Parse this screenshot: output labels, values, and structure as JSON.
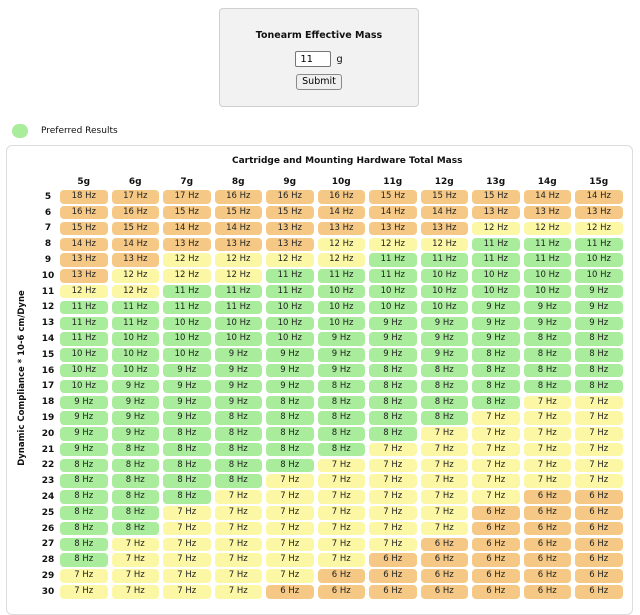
{
  "form": {
    "title": "Tonearm Effective Mass",
    "mass_value": "11",
    "unit": "g",
    "submit_label": "Submit"
  },
  "legend": {
    "label": "Preferred Results",
    "color": "#a8ec9c"
  },
  "colors": {
    "orange": "#f5c985",
    "yellow": "#fcf7a5",
    "green": "#a8ec9c"
  },
  "table": {
    "title": "Cartridge and Mounting Hardware Total Mass",
    "y_label": "Dynamic Compliance * 10-6 cm/Dyne",
    "columns": [
      "5g",
      "6g",
      "7g",
      "8g",
      "9g",
      "10g",
      "11g",
      "12g",
      "13g",
      "14g",
      "15g"
    ],
    "rows": [
      {
        "label": "5",
        "cells": [
          [
            "18 Hz",
            "o"
          ],
          [
            "17 Hz",
            "o"
          ],
          [
            "17 Hz",
            "o"
          ],
          [
            "16 Hz",
            "o"
          ],
          [
            "16 Hz",
            "o"
          ],
          [
            "16 Hz",
            "o"
          ],
          [
            "15 Hz",
            "o"
          ],
          [
            "15 Hz",
            "o"
          ],
          [
            "15 Hz",
            "o"
          ],
          [
            "14 Hz",
            "o"
          ],
          [
            "14 Hz",
            "o"
          ]
        ]
      },
      {
        "label": "6",
        "cells": [
          [
            "16 Hz",
            "o"
          ],
          [
            "16 Hz",
            "o"
          ],
          [
            "15 Hz",
            "o"
          ],
          [
            "15 Hz",
            "o"
          ],
          [
            "15 Hz",
            "o"
          ],
          [
            "14 Hz",
            "o"
          ],
          [
            "14 Hz",
            "o"
          ],
          [
            "14 Hz",
            "o"
          ],
          [
            "13 Hz",
            "o"
          ],
          [
            "13 Hz",
            "o"
          ],
          [
            "13 Hz",
            "o"
          ]
        ]
      },
      {
        "label": "7",
        "cells": [
          [
            "15 Hz",
            "o"
          ],
          [
            "15 Hz",
            "o"
          ],
          [
            "14 Hz",
            "o"
          ],
          [
            "14 Hz",
            "o"
          ],
          [
            "13 Hz",
            "o"
          ],
          [
            "13 Hz",
            "o"
          ],
          [
            "13 Hz",
            "o"
          ],
          [
            "13 Hz",
            "o"
          ],
          [
            "12 Hz",
            "y"
          ],
          [
            "12 Hz",
            "y"
          ],
          [
            "12 Hz",
            "y"
          ]
        ]
      },
      {
        "label": "8",
        "cells": [
          [
            "14 Hz",
            "o"
          ],
          [
            "14 Hz",
            "o"
          ],
          [
            "13 Hz",
            "o"
          ],
          [
            "13 Hz",
            "o"
          ],
          [
            "13 Hz",
            "o"
          ],
          [
            "12 Hz",
            "y"
          ],
          [
            "12 Hz",
            "y"
          ],
          [
            "12 Hz",
            "y"
          ],
          [
            "11 Hz",
            "g"
          ],
          [
            "11 Hz",
            "g"
          ],
          [
            "11 Hz",
            "g"
          ]
        ]
      },
      {
        "label": "9",
        "cells": [
          [
            "13 Hz",
            "o"
          ],
          [
            "13 Hz",
            "o"
          ],
          [
            "12 Hz",
            "y"
          ],
          [
            "12 Hz",
            "y"
          ],
          [
            "12 Hz",
            "y"
          ],
          [
            "12 Hz",
            "y"
          ],
          [
            "11 Hz",
            "g"
          ],
          [
            "11 Hz",
            "g"
          ],
          [
            "11 Hz",
            "g"
          ],
          [
            "11 Hz",
            "g"
          ],
          [
            "10 Hz",
            "g"
          ]
        ]
      },
      {
        "label": "10",
        "cells": [
          [
            "13 Hz",
            "o"
          ],
          [
            "12 Hz",
            "y"
          ],
          [
            "12 Hz",
            "y"
          ],
          [
            "12 Hz",
            "y"
          ],
          [
            "11 Hz",
            "g"
          ],
          [
            "11 Hz",
            "g"
          ],
          [
            "11 Hz",
            "g"
          ],
          [
            "10 Hz",
            "g"
          ],
          [
            "10 Hz",
            "g"
          ],
          [
            "10 Hz",
            "g"
          ],
          [
            "10 Hz",
            "g"
          ]
        ]
      },
      {
        "label": "11",
        "cells": [
          [
            "12 Hz",
            "y"
          ],
          [
            "12 Hz",
            "y"
          ],
          [
            "11 Hz",
            "g"
          ],
          [
            "11 Hz",
            "g"
          ],
          [
            "11 Hz",
            "g"
          ],
          [
            "10 Hz",
            "g"
          ],
          [
            "10 Hz",
            "g"
          ],
          [
            "10 Hz",
            "g"
          ],
          [
            "10 Hz",
            "g"
          ],
          [
            "10 Hz",
            "g"
          ],
          [
            "9 Hz",
            "g"
          ]
        ]
      },
      {
        "label": "12",
        "cells": [
          [
            "11 Hz",
            "g"
          ],
          [
            "11 Hz",
            "g"
          ],
          [
            "11 Hz",
            "g"
          ],
          [
            "11 Hz",
            "g"
          ],
          [
            "10 Hz",
            "g"
          ],
          [
            "10 Hz",
            "g"
          ],
          [
            "10 Hz",
            "g"
          ],
          [
            "10 Hz",
            "g"
          ],
          [
            "9 Hz",
            "g"
          ],
          [
            "9 Hz",
            "g"
          ],
          [
            "9 Hz",
            "g"
          ]
        ]
      },
      {
        "label": "13",
        "cells": [
          [
            "11 Hz",
            "g"
          ],
          [
            "11 Hz",
            "g"
          ],
          [
            "10 Hz",
            "g"
          ],
          [
            "10 Hz",
            "g"
          ],
          [
            "10 Hz",
            "g"
          ],
          [
            "10 Hz",
            "g"
          ],
          [
            "9 Hz",
            "g"
          ],
          [
            "9 Hz",
            "g"
          ],
          [
            "9 Hz",
            "g"
          ],
          [
            "9 Hz",
            "g"
          ],
          [
            "9 Hz",
            "g"
          ]
        ]
      },
      {
        "label": "14",
        "cells": [
          [
            "11 Hz",
            "g"
          ],
          [
            "10 Hz",
            "g"
          ],
          [
            "10 Hz",
            "g"
          ],
          [
            "10 Hz",
            "g"
          ],
          [
            "10 Hz",
            "g"
          ],
          [
            "9 Hz",
            "g"
          ],
          [
            "9 Hz",
            "g"
          ],
          [
            "9 Hz",
            "g"
          ],
          [
            "9 Hz",
            "g"
          ],
          [
            "8 Hz",
            "g"
          ],
          [
            "8 Hz",
            "g"
          ]
        ]
      },
      {
        "label": "15",
        "cells": [
          [
            "10 Hz",
            "g"
          ],
          [
            "10 Hz",
            "g"
          ],
          [
            "10 Hz",
            "g"
          ],
          [
            "9 Hz",
            "g"
          ],
          [
            "9 Hz",
            "g"
          ],
          [
            "9 Hz",
            "g"
          ],
          [
            "9 Hz",
            "g"
          ],
          [
            "9 Hz",
            "g"
          ],
          [
            "8 Hz",
            "g"
          ],
          [
            "8 Hz",
            "g"
          ],
          [
            "8 Hz",
            "g"
          ]
        ]
      },
      {
        "label": "16",
        "cells": [
          [
            "10 Hz",
            "g"
          ],
          [
            "10 Hz",
            "g"
          ],
          [
            "9 Hz",
            "g"
          ],
          [
            "9 Hz",
            "g"
          ],
          [
            "9 Hz",
            "g"
          ],
          [
            "9 Hz",
            "g"
          ],
          [
            "8 Hz",
            "g"
          ],
          [
            "8 Hz",
            "g"
          ],
          [
            "8 Hz",
            "g"
          ],
          [
            "8 Hz",
            "g"
          ],
          [
            "8 Hz",
            "g"
          ]
        ]
      },
      {
        "label": "17",
        "cells": [
          [
            "10 Hz",
            "g"
          ],
          [
            "9 Hz",
            "g"
          ],
          [
            "9 Hz",
            "g"
          ],
          [
            "9 Hz",
            "g"
          ],
          [
            "9 Hz",
            "g"
          ],
          [
            "8 Hz",
            "g"
          ],
          [
            "8 Hz",
            "g"
          ],
          [
            "8 Hz",
            "g"
          ],
          [
            "8 Hz",
            "g"
          ],
          [
            "8 Hz",
            "g"
          ],
          [
            "8 Hz",
            "g"
          ]
        ]
      },
      {
        "label": "18",
        "cells": [
          [
            "9 Hz",
            "g"
          ],
          [
            "9 Hz",
            "g"
          ],
          [
            "9 Hz",
            "g"
          ],
          [
            "9 Hz",
            "g"
          ],
          [
            "8 Hz",
            "g"
          ],
          [
            "8 Hz",
            "g"
          ],
          [
            "8 Hz",
            "g"
          ],
          [
            "8 Hz",
            "g"
          ],
          [
            "8 Hz",
            "g"
          ],
          [
            "7 Hz",
            "y"
          ],
          [
            "7 Hz",
            "y"
          ]
        ]
      },
      {
        "label": "19",
        "cells": [
          [
            "9 Hz",
            "g"
          ],
          [
            "9 Hz",
            "g"
          ],
          [
            "9 Hz",
            "g"
          ],
          [
            "8 Hz",
            "g"
          ],
          [
            "8 Hz",
            "g"
          ],
          [
            "8 Hz",
            "g"
          ],
          [
            "8 Hz",
            "g"
          ],
          [
            "8 Hz",
            "g"
          ],
          [
            "7 Hz",
            "y"
          ],
          [
            "7 Hz",
            "y"
          ],
          [
            "7 Hz",
            "y"
          ]
        ]
      },
      {
        "label": "20",
        "cells": [
          [
            "9 Hz",
            "g"
          ],
          [
            "9 Hz",
            "g"
          ],
          [
            "8 Hz",
            "g"
          ],
          [
            "8 Hz",
            "g"
          ],
          [
            "8 Hz",
            "g"
          ],
          [
            "8 Hz",
            "g"
          ],
          [
            "8 Hz",
            "g"
          ],
          [
            "7 Hz",
            "y"
          ],
          [
            "7 Hz",
            "y"
          ],
          [
            "7 Hz",
            "y"
          ],
          [
            "7 Hz",
            "y"
          ]
        ]
      },
      {
        "label": "21",
        "cells": [
          [
            "9 Hz",
            "g"
          ],
          [
            "8 Hz",
            "g"
          ],
          [
            "8 Hz",
            "g"
          ],
          [
            "8 Hz",
            "g"
          ],
          [
            "8 Hz",
            "g"
          ],
          [
            "8 Hz",
            "g"
          ],
          [
            "7 Hz",
            "y"
          ],
          [
            "7 Hz",
            "y"
          ],
          [
            "7 Hz",
            "y"
          ],
          [
            "7 Hz",
            "y"
          ],
          [
            "7 Hz",
            "y"
          ]
        ]
      },
      {
        "label": "22",
        "cells": [
          [
            "8 Hz",
            "g"
          ],
          [
            "8 Hz",
            "g"
          ],
          [
            "8 Hz",
            "g"
          ],
          [
            "8 Hz",
            "g"
          ],
          [
            "8 Hz",
            "g"
          ],
          [
            "7 Hz",
            "y"
          ],
          [
            "7 Hz",
            "y"
          ],
          [
            "7 Hz",
            "y"
          ],
          [
            "7 Hz",
            "y"
          ],
          [
            "7 Hz",
            "y"
          ],
          [
            "7 Hz",
            "y"
          ]
        ]
      },
      {
        "label": "23",
        "cells": [
          [
            "8 Hz",
            "g"
          ],
          [
            "8 Hz",
            "g"
          ],
          [
            "8 Hz",
            "g"
          ],
          [
            "8 Hz",
            "g"
          ],
          [
            "7 Hz",
            "y"
          ],
          [
            "7 Hz",
            "y"
          ],
          [
            "7 Hz",
            "y"
          ],
          [
            "7 Hz",
            "y"
          ],
          [
            "7 Hz",
            "y"
          ],
          [
            "7 Hz",
            "y"
          ],
          [
            "7 Hz",
            "y"
          ]
        ]
      },
      {
        "label": "24",
        "cells": [
          [
            "8 Hz",
            "g"
          ],
          [
            "8 Hz",
            "g"
          ],
          [
            "8 Hz",
            "g"
          ],
          [
            "7 Hz",
            "y"
          ],
          [
            "7 Hz",
            "y"
          ],
          [
            "7 Hz",
            "y"
          ],
          [
            "7 Hz",
            "y"
          ],
          [
            "7 Hz",
            "y"
          ],
          [
            "7 Hz",
            "y"
          ],
          [
            "6 Hz",
            "o"
          ],
          [
            "6 Hz",
            "o"
          ]
        ]
      },
      {
        "label": "25",
        "cells": [
          [
            "8 Hz",
            "g"
          ],
          [
            "8 Hz",
            "g"
          ],
          [
            "7 Hz",
            "y"
          ],
          [
            "7 Hz",
            "y"
          ],
          [
            "7 Hz",
            "y"
          ],
          [
            "7 Hz",
            "y"
          ],
          [
            "7 Hz",
            "y"
          ],
          [
            "7 Hz",
            "y"
          ],
          [
            "6 Hz",
            "o"
          ],
          [
            "6 Hz",
            "o"
          ],
          [
            "6 Hz",
            "o"
          ]
        ]
      },
      {
        "label": "26",
        "cells": [
          [
            "8 Hz",
            "g"
          ],
          [
            "8 Hz",
            "g"
          ],
          [
            "7 Hz",
            "y"
          ],
          [
            "7 Hz",
            "y"
          ],
          [
            "7 Hz",
            "y"
          ],
          [
            "7 Hz",
            "y"
          ],
          [
            "7 Hz",
            "y"
          ],
          [
            "7 Hz",
            "y"
          ],
          [
            "6 Hz",
            "o"
          ],
          [
            "6 Hz",
            "o"
          ],
          [
            "6 Hz",
            "o"
          ]
        ]
      },
      {
        "label": "27",
        "cells": [
          [
            "8 Hz",
            "g"
          ],
          [
            "7 Hz",
            "y"
          ],
          [
            "7 Hz",
            "y"
          ],
          [
            "7 Hz",
            "y"
          ],
          [
            "7 Hz",
            "y"
          ],
          [
            "7 Hz",
            "y"
          ],
          [
            "7 Hz",
            "y"
          ],
          [
            "6 Hz",
            "o"
          ],
          [
            "6 Hz",
            "o"
          ],
          [
            "6 Hz",
            "o"
          ],
          [
            "6 Hz",
            "o"
          ]
        ]
      },
      {
        "label": "28",
        "cells": [
          [
            "8 Hz",
            "g"
          ],
          [
            "7 Hz",
            "y"
          ],
          [
            "7 Hz",
            "y"
          ],
          [
            "7 Hz",
            "y"
          ],
          [
            "7 Hz",
            "y"
          ],
          [
            "7 Hz",
            "y"
          ],
          [
            "6 Hz",
            "o"
          ],
          [
            "6 Hz",
            "o"
          ],
          [
            "6 Hz",
            "o"
          ],
          [
            "6 Hz",
            "o"
          ],
          [
            "6 Hz",
            "o"
          ]
        ]
      },
      {
        "label": "29",
        "cells": [
          [
            "7 Hz",
            "y"
          ],
          [
            "7 Hz",
            "y"
          ],
          [
            "7 Hz",
            "y"
          ],
          [
            "7 Hz",
            "y"
          ],
          [
            "7 Hz",
            "y"
          ],
          [
            "6 Hz",
            "o"
          ],
          [
            "6 Hz",
            "o"
          ],
          [
            "6 Hz",
            "o"
          ],
          [
            "6 Hz",
            "o"
          ],
          [
            "6 Hz",
            "o"
          ],
          [
            "6 Hz",
            "o"
          ]
        ]
      },
      {
        "label": "30",
        "cells": [
          [
            "7 Hz",
            "y"
          ],
          [
            "7 Hz",
            "y"
          ],
          [
            "7 Hz",
            "y"
          ],
          [
            "7 Hz",
            "y"
          ],
          [
            "6 Hz",
            "o"
          ],
          [
            "6 Hz",
            "o"
          ],
          [
            "6 Hz",
            "o"
          ],
          [
            "6 Hz",
            "o"
          ],
          [
            "6 Hz",
            "o"
          ],
          [
            "6 Hz",
            "o"
          ],
          [
            "6 Hz",
            "o"
          ]
        ]
      }
    ]
  }
}
